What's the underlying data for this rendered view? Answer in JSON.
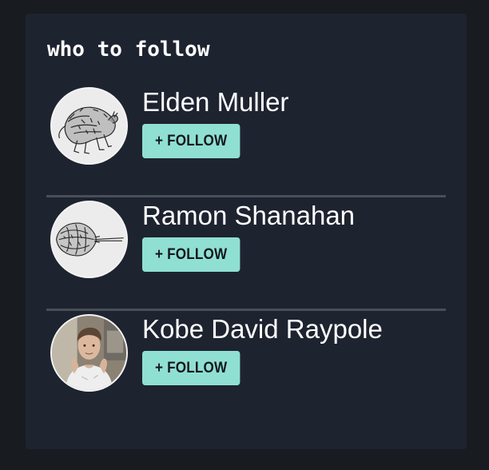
{
  "widget": {
    "title": "who to follow"
  },
  "users": [
    {
      "name": "Elden Muller",
      "follow_label": "+ FOLLOW",
      "avatar_icon": "wolf-sketch-avatar"
    },
    {
      "name": "Ramon Shanahan",
      "follow_label": "+ FOLLOW",
      "avatar_icon": "horseshoe-crab-sketch-avatar"
    },
    {
      "name": "Kobe David Raypole",
      "follow_label": "+ FOLLOW",
      "avatar_icon": "person-photo-avatar"
    }
  ],
  "colors": {
    "page_background": "#181b20",
    "card_background": "#1e2330",
    "follow_button": "#8fe0d2",
    "divider": "#4a4e58",
    "text": "#ffffff"
  }
}
